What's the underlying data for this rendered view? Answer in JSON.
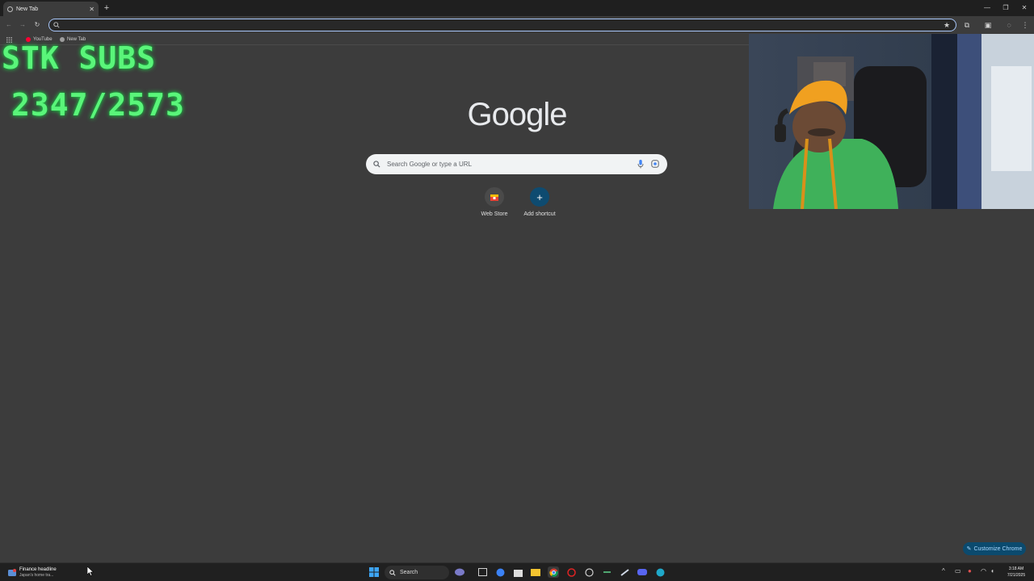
{
  "browser": {
    "tab_title": "New Tab",
    "address_value": "",
    "bookmarks": [
      {
        "label": "YouTube",
        "color": "#ff0033"
      },
      {
        "label": "New Tab",
        "color": "#9e9e9e"
      }
    ]
  },
  "overlay": {
    "line1": "STK SUBS",
    "line2": "2347/2573"
  },
  "newtab": {
    "logo": "Google",
    "search_placeholder": "Search Google or type a URL",
    "shortcuts": [
      {
        "label": "Web Store",
        "icon": "web-store-icon"
      },
      {
        "label": "Add shortcut",
        "icon": "plus-icon"
      }
    ],
    "customize_label": "Customize Chrome"
  },
  "taskbar": {
    "news_title": "Finance headline",
    "news_subtitle": "Japan's home tra...",
    "search_label": "Search",
    "time": "3:18 AM",
    "date": "7/21/2025"
  },
  "colors": {
    "accent": "#a8c7fa",
    "overlay_green": "#5af57a",
    "page_bg": "#3c3c3c"
  }
}
